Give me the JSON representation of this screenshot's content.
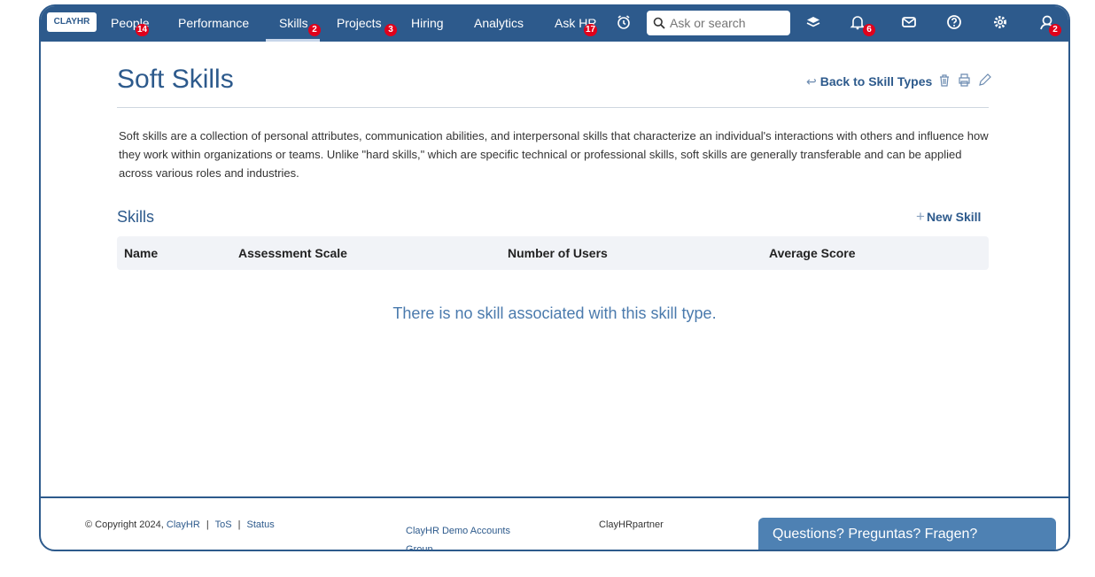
{
  "brand": {
    "logo_text": "CLAYHR"
  },
  "nav": {
    "items": [
      {
        "label": "People",
        "badge": "14"
      },
      {
        "label": "Performance",
        "badge": ""
      },
      {
        "label": "Skills",
        "badge": "2"
      },
      {
        "label": "Projects",
        "badge": "3"
      },
      {
        "label": "Hiring",
        "badge": ""
      },
      {
        "label": "Analytics",
        "badge": ""
      },
      {
        "label": "Ask HR",
        "badge": "17"
      }
    ],
    "search_placeholder": "Ask or search",
    "notifications_badge": "6",
    "profile_badge": "2"
  },
  "page": {
    "title": "Soft Skills",
    "back_link": "Back to Skill Types",
    "description": "Soft skills are a collection of personal attributes, communication abilities, and interpersonal skills that characterize an individual's interactions with others and influence how they work within organizations or teams. Unlike \"hard skills,\" which are specific technical or professional skills, soft skills are generally transferable and can be applied across various roles and industries."
  },
  "skills": {
    "section_title": "Skills",
    "new_button": "New Skill",
    "columns": [
      "Name",
      "Assessment Scale",
      "Number of Users",
      "Average Score"
    ],
    "empty_message": "There is no skill associated with this skill type."
  },
  "footer": {
    "copyright": "© Copyright 2024,",
    "brand_link": "ClayHR",
    "tos": "ToS",
    "status": "Status",
    "separator": "|",
    "account_line1": "ClayHR Demo Accounts",
    "account_line2": "Group",
    "partner": "ClayHRpartner",
    "chat": "Questions? Preguntas? Fragen?"
  },
  "colors": {
    "primary": "#2d5a8c",
    "badge": "#e0001b",
    "chat": "#4e81b3"
  }
}
